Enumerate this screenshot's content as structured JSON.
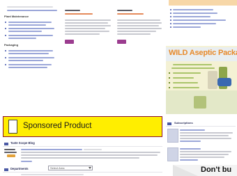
{
  "sponsored": {
    "label": "Sponsored Product"
  },
  "ads": {
    "wild_banner_title": "WILD Aseptic Packag",
    "dont_banner_text": "Don't bu"
  },
  "sidebar": {
    "plant_maintenance_heading": "Plant Maintenance",
    "packaging_heading": "Packaging"
  },
  "sections": {
    "blog_title": "Taste Scope Blog",
    "departments_title": "Departments",
    "departments_select": "Select Area",
    "subscriptions_title": "Subscriptions"
  },
  "colors": {
    "sponsored_bg": "#ffee00",
    "sponsored_border": "#8a0e2e",
    "accent_purple": "#9b3c8f",
    "ad_orange": "#f29a3c"
  }
}
